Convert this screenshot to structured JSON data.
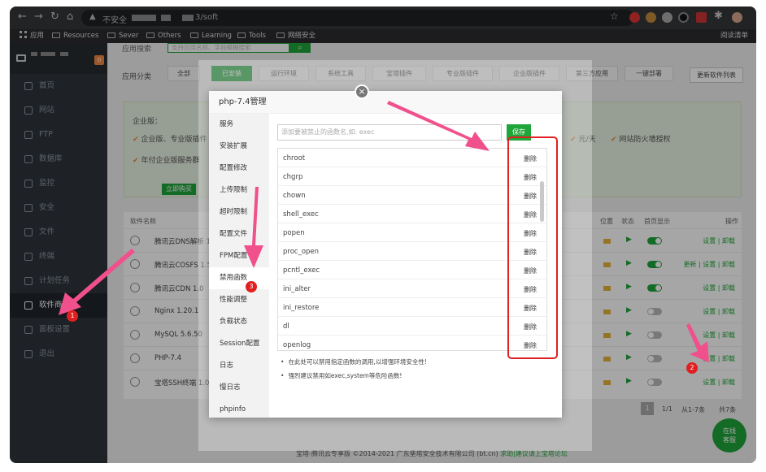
{
  "browser": {
    "insecure_label": "不安全",
    "url_path": "3/soft",
    "bookmarks": [
      {
        "label": "应用"
      },
      {
        "label": "Resources"
      },
      {
        "label": "Sever"
      },
      {
        "label": "Others"
      },
      {
        "label": "Learning"
      },
      {
        "label": "Tools"
      },
      {
        "label": "网络安全"
      }
    ],
    "reading_list": "阅读清单"
  },
  "sidebar": {
    "badge": "0",
    "items": [
      {
        "label": "首页"
      },
      {
        "label": "网站"
      },
      {
        "label": "FTP"
      },
      {
        "label": "数据库"
      },
      {
        "label": "监控"
      },
      {
        "label": "安全"
      },
      {
        "label": "文件"
      },
      {
        "label": "终端"
      },
      {
        "label": "计划任务"
      },
      {
        "label": "软件商店"
      },
      {
        "label": "面板设置"
      },
      {
        "label": "退出"
      }
    ]
  },
  "store": {
    "search_label": "应用搜索",
    "search_placeholder": "支持应用名称、字段模糊搜索",
    "category_label": "应用分类",
    "categories": [
      "全部",
      "已安装",
      "运行环境",
      "系统工具",
      "宝塔插件",
      "专业版插件",
      "企业版插件",
      "第三方应用",
      "一键部署"
    ],
    "refresh": "更新软件列表",
    "enterprise": {
      "title": "企业版：",
      "line1": "企业版、专业版插件",
      "line2": "年付企业版服务群",
      "right1": "元/天",
      "right2": "网站防火墙授权",
      "buy": "立即购买"
    },
    "table": {
      "headers": {
        "name": "软件名称",
        "loc": "位置",
        "status": "状态",
        "home": "首页显示",
        "ops": "操作"
      },
      "rows": [
        {
          "name": "腾讯云DNS解析 1.0",
          "home_on": true,
          "ops": "设置 | 卸载"
        },
        {
          "name": "腾讯云COSFS 1.5",
          "home_on": true,
          "ops": "更新 | 设置 | 卸载"
        },
        {
          "name": "腾讯云CDN 1.0",
          "home_on": true,
          "ops": "设置 | 卸载"
        },
        {
          "name": "Nginx 1.20.1",
          "home_on": false,
          "ops": "设置 | 卸载"
        },
        {
          "name": "MySQL 5.6.50",
          "home_on": false,
          "ops": "设置 | 卸载"
        },
        {
          "name": "PHP-7.4",
          "home_on": false,
          "ops": "设置 | 卸载"
        },
        {
          "name": "宝塔SSH终端 1.0",
          "home_on": false,
          "ops": "设置 | 卸载"
        }
      ]
    },
    "pager": {
      "page": "1",
      "pages": "1/1",
      "range": "从1-7条",
      "total": "共7条"
    },
    "footer_text": "宝塔-腾讯云专享版 ©2014-2021 广东堡塔安全技术有限公司 (bt.cn)",
    "footer_link": "求助|建议请上宝塔论坛",
    "chat": [
      "在线",
      "客服"
    ]
  },
  "dialog": {
    "title": "php-7.4管理",
    "close": "×",
    "menu": [
      "服务",
      "安装扩展",
      "配置修改",
      "上传限制",
      "超时限制",
      "配置文件",
      "FPM配置",
      "禁用函数",
      "性能调整",
      "负载状态",
      "Session配置",
      "日志",
      "慢日志",
      "phpinfo"
    ],
    "active_menu": 7,
    "input_placeholder": "添加要被禁止的函数名,如: exec",
    "save": "保存",
    "delete_label": "删除",
    "functions": [
      "chroot",
      "chgrp",
      "chown",
      "shell_exec",
      "popen",
      "proc_open",
      "pcntl_exec",
      "ini_alter",
      "ini_restore",
      "dl",
      "openlog"
    ],
    "notes": [
      "在此处可以禁用指定函数的调用,以增强环境安全性!",
      "强烈建议禁用如exec,system等危险函数!"
    ]
  },
  "annotations": {
    "steps": [
      "1",
      "2",
      "3"
    ],
    "color": "#e02020"
  }
}
